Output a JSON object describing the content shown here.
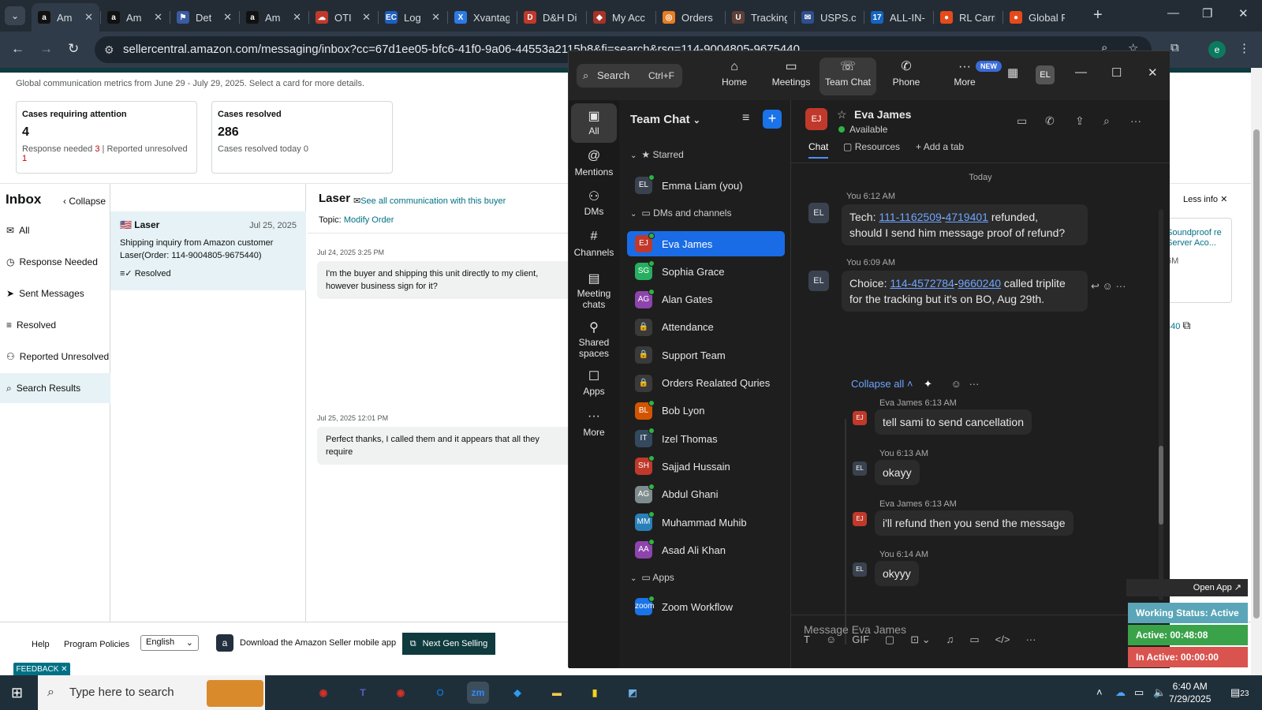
{
  "browser": {
    "tabs": [
      {
        "title": "Am",
        "favicon": "a",
        "color": "#111111",
        "active": true,
        "close": "✕"
      },
      {
        "title": "Am",
        "favicon": "a",
        "color": "#111111",
        "close": "✕"
      },
      {
        "title": "Det",
        "favicon": "⚑",
        "color": "#3a5ba0",
        "close": "✕"
      },
      {
        "title": "Am",
        "favicon": "a",
        "color": "#111111",
        "close": "✕"
      },
      {
        "title": "OTI",
        "favicon": "☁",
        "color": "#c0392b",
        "close": "✕"
      },
      {
        "title": "Log",
        "favicon": "EC",
        "color": "#1e5fbf",
        "close": "✕"
      },
      {
        "title": "Xvantag",
        "favicon": "X",
        "color": "#2c7be5"
      },
      {
        "title": "D&H Di",
        "favicon": "D",
        "color": "#c0392b"
      },
      {
        "title": "My Acc",
        "favicon": "◆",
        "color": "#a93226"
      },
      {
        "title": "Orders",
        "favicon": "◎",
        "color": "#e67e22"
      },
      {
        "title": "Tracking",
        "favicon": "U",
        "color": "#5d4037"
      },
      {
        "title": "USPS.co",
        "favicon": "✉",
        "color": "#2e4e8c"
      },
      {
        "title": "ALL-IN-",
        "favicon": "17",
        "color": "#1565c0"
      },
      {
        "title": "RL Carri",
        "favicon": "●",
        "color": "#e64a19"
      },
      {
        "title": "Global F",
        "favicon": "●",
        "color": "#e64a19"
      }
    ],
    "new_tab": "+",
    "url": "sellercentral.amazon.com/messaging/inbox?cc=67d1ee05-bfc6-41f0-9a06-44553a2115b8&fi=search&rsq=114-9004805-9675440",
    "profile_initial": "e"
  },
  "amazon": {
    "metrics_text": "Global communication metrics from June 29 - July 29, 2025. Select a card for more details.",
    "cards": [
      {
        "title": "Cases requiring attention",
        "value": "4",
        "sub_a": "Response needed",
        "sub_a_val": "3",
        "sub_b": "Reported unresolved",
        "sub_b_val": "1"
      },
      {
        "title": "Cases resolved",
        "value": "286",
        "sub_a": "Cases resolved today 0"
      }
    ],
    "inbox_title": "Inbox",
    "collapse_label": "Collapse",
    "nav": [
      {
        "icon": "✉",
        "label": "All"
      },
      {
        "icon": "◷",
        "label": "Response Needed"
      },
      {
        "icon": "➤",
        "label": "Sent Messages"
      },
      {
        "icon": "≡",
        "label": "Resolved"
      },
      {
        "icon": "⚇",
        "label": "Reported Unresolved"
      },
      {
        "icon": "⌕",
        "label": "Search Results"
      }
    ],
    "conversation": {
      "flag": "🇺🇸",
      "name": "Laser",
      "date": "Jul 25, 2025",
      "line1": "Shipping inquiry from Amazon customer",
      "line2": "Laser(Order: 114-9004805-9675440)",
      "status": "Resolved"
    },
    "thread": {
      "buyer": "Laser",
      "see_all": "See all communication with this buyer",
      "topic_label": "Topic:",
      "topic": "Modify Order",
      "messages": [
        {
          "date": "Jul 24, 2025 3:25 PM",
          "text": "I'm the buyer and shipping this unit directly to my client, however business sign for it?"
        },
        {
          "date": "Jul 25, 2025 12:01 PM",
          "text": "Perfect thanks, I called them and it appears that all they require"
        }
      ]
    },
    "less_info": "Less info",
    "right_card": {
      "title": "Soundproof re Server Aco...",
      "sub": "6M"
    },
    "right_num": "440",
    "footer": {
      "help": "Help",
      "policies": "Program Policies",
      "language": "English",
      "download": "Download the Amazon Seller mobile app",
      "next_gen": "Next Gen Selling"
    },
    "feedback": "FEEDBACK ✕"
  },
  "zoom": {
    "search_label": "Search",
    "search_shortcut": "Ctrl+F",
    "top_tabs": [
      {
        "icon": "⌂",
        "label": "Home"
      },
      {
        "icon": "▭",
        "label": "Meetings"
      },
      {
        "icon": "☏",
        "label": "Team Chat"
      },
      {
        "icon": "✆",
        "label": "Phone"
      },
      {
        "icon": "···",
        "label": "More"
      }
    ],
    "new_badge": "NEW",
    "user_initials": "EL",
    "rail": [
      {
        "icon": "▣",
        "label": "All"
      },
      {
        "icon": "@",
        "label": "Mentions"
      },
      {
        "icon": "⚇",
        "label": "DMs"
      },
      {
        "icon": "#",
        "label": "Channels"
      },
      {
        "icon": "▤",
        "label": "Meeting chats"
      },
      {
        "icon": "⚲",
        "label": "Shared spaces"
      },
      {
        "icon": "☐",
        "label": "Apps"
      },
      {
        "icon": "···",
        "label": "More"
      }
    ],
    "list_title": "Team Chat",
    "sections": {
      "starred": "Starred",
      "dms": "DMs and channels",
      "apps": "Apps"
    },
    "starred": [
      {
        "initials": "EL",
        "name": "Emma Liam (you)",
        "color": "#3a4250"
      }
    ],
    "contacts": [
      {
        "initials": "EJ",
        "name": "Eva James",
        "color": "#c0392b",
        "selected": true
      },
      {
        "initials": "SG",
        "name": "Sophia Grace",
        "color": "#27ae60"
      },
      {
        "initials": "AG",
        "name": "Alan Gates",
        "color": "#8e44ad"
      },
      {
        "initials": "🔒",
        "name": "Attendance",
        "color": "#3a3a3a"
      },
      {
        "initials": "🔒",
        "name": "Support Team",
        "color": "#3a3a3a"
      },
      {
        "initials": "🔒",
        "name": "Orders Realated Quries",
        "color": "#3a3a3a"
      },
      {
        "initials": "BL",
        "name": "Bob Lyon",
        "color": "#d35400"
      },
      {
        "initials": "IT",
        "name": "Izel Thomas",
        "color": "#34495e"
      },
      {
        "initials": "SH",
        "name": "Sajjad Hussain",
        "color": "#c0392b"
      },
      {
        "initials": "AG",
        "name": "Abdul Ghani",
        "color": "#7f8c8d"
      },
      {
        "initials": "MM",
        "name": "Muhammad Muhib",
        "color": "#2980b9"
      },
      {
        "initials": "AA",
        "name": "Asad Ali Khan",
        "color": "#8e44ad"
      }
    ],
    "apps": [
      {
        "initials": "zoom",
        "name": "Zoom Workflow",
        "color": "#1a73e8"
      }
    ],
    "chat": {
      "contact": "Eva James",
      "contact_initials": "EJ",
      "status": "Available",
      "tabs": [
        "Chat",
        "Resources",
        "Add a tab"
      ],
      "day": "Today",
      "messages": [
        {
          "who": "You 6:12 AM",
          "initials": "EL",
          "pre": "Tech: ",
          "link1": "111-1162509",
          "dash": "-",
          "link2": "4719401",
          "post": " refunded,",
          "line2": "should I send him message proof of refund?"
        },
        {
          "who": "You 6:09 AM",
          "initials": "EL",
          "pre": "Choice: ",
          "link1": "114-4572784",
          "dash": "-",
          "link2": "9660240",
          "post": " called triplite",
          "line2": "for the tracking but it's on BO, Aug 29th."
        }
      ],
      "collapse_all": "Collapse all",
      "replies": [
        {
          "who": "Eva James 6:13 AM",
          "initials": "EJ",
          "text": "tell sami to send cancellation",
          "color": "#c0392b"
        },
        {
          "who": "You 6:13 AM",
          "initials": "EL",
          "text": "okayy",
          "color": "#3a4250"
        },
        {
          "who": "Eva James 6:13 AM",
          "initials": "EJ",
          "text": "i'll refund then you send the message",
          "color": "#c0392b"
        },
        {
          "who": "You 6:14 AM",
          "initials": "EL",
          "text": "okyyy",
          "color": "#3a4250"
        }
      ],
      "compose_placeholder": "Message Eva James",
      "tools": [
        "T",
        "☺",
        "GIF",
        "▢",
        "⊡ ⌄",
        "♫",
        "▭",
        "</>",
        "···"
      ]
    }
  },
  "widget": {
    "open_app": "Open App ↗",
    "working_status": "Working Status: Active",
    "active": "Active: 00:48:08",
    "inactive": "In Active: 00:00:00",
    "colors": {
      "status": "#5aa6b8",
      "active": "#3aa34a",
      "inactive": "#d9534f"
    }
  },
  "taskbar": {
    "search_placeholder": "Type here to search",
    "apps": [
      {
        "label": "⧉",
        "color": "#1f2f3a"
      },
      {
        "label": "◉",
        "color": "#d93025"
      },
      {
        "label": "T",
        "color": "#5b5fc7"
      },
      {
        "label": "◉",
        "color": "#d93025"
      },
      {
        "label": "O",
        "color": "#0f6cbd"
      },
      {
        "label": "zm",
        "color": "#2d8cff"
      },
      {
        "label": "◆",
        "color": "#2a9df4"
      },
      {
        "label": "▬",
        "color": "#f2c94c"
      },
      {
        "label": "▮",
        "color": "#f7d21e"
      },
      {
        "label": "◩",
        "color": "#6fb5e6"
      }
    ],
    "time": "6:40 AM",
    "date": "7/29/2025",
    "notif_count": "23"
  }
}
